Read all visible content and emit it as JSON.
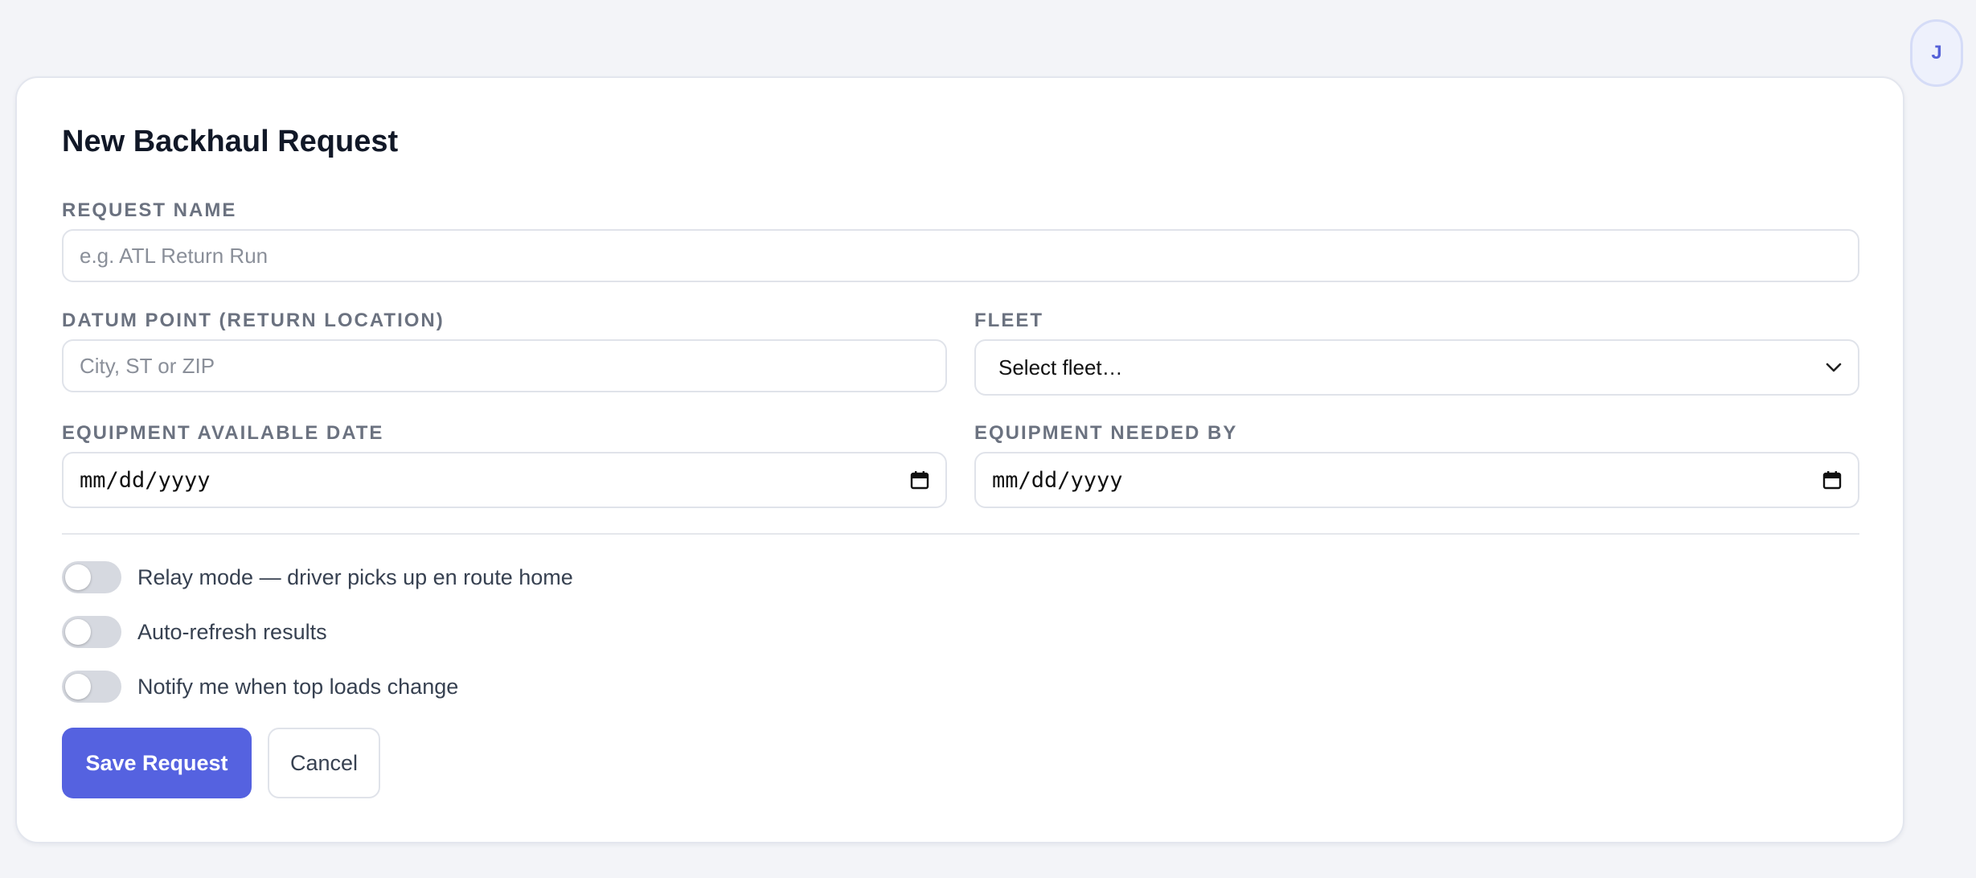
{
  "user": {
    "avatar_initial": "J"
  },
  "form": {
    "title": "New Backhaul Request",
    "request_name": {
      "label": "REQUEST NAME",
      "placeholder": "e.g. ATL Return Run",
      "value": ""
    },
    "datum_point": {
      "label": "DATUM POINT (RETURN LOCATION)",
      "placeholder": "City, ST or ZIP",
      "value": ""
    },
    "fleet": {
      "label": "FLEET",
      "selected": "Select fleet…"
    },
    "equipment_available": {
      "label": "EQUIPMENT AVAILABLE DATE",
      "value": "mm/dd/yyyy"
    },
    "equipment_needed": {
      "label": "EQUIPMENT NEEDED BY",
      "value": "mm/dd/yyyy"
    },
    "toggles": [
      {
        "label": "Relay mode — driver picks up en route home",
        "on": false
      },
      {
        "label": "Auto-refresh results",
        "on": false
      },
      {
        "label": "Notify me when top loads change",
        "on": false
      }
    ],
    "save_label": "Save Request",
    "cancel_label": "Cancel"
  },
  "icons": {
    "select_caret": "chevron-down-icon",
    "date_picker": "calendar-icon"
  },
  "colors": {
    "accent": "#5562e0",
    "background": "#f3f4f8",
    "card": "#ffffff"
  }
}
